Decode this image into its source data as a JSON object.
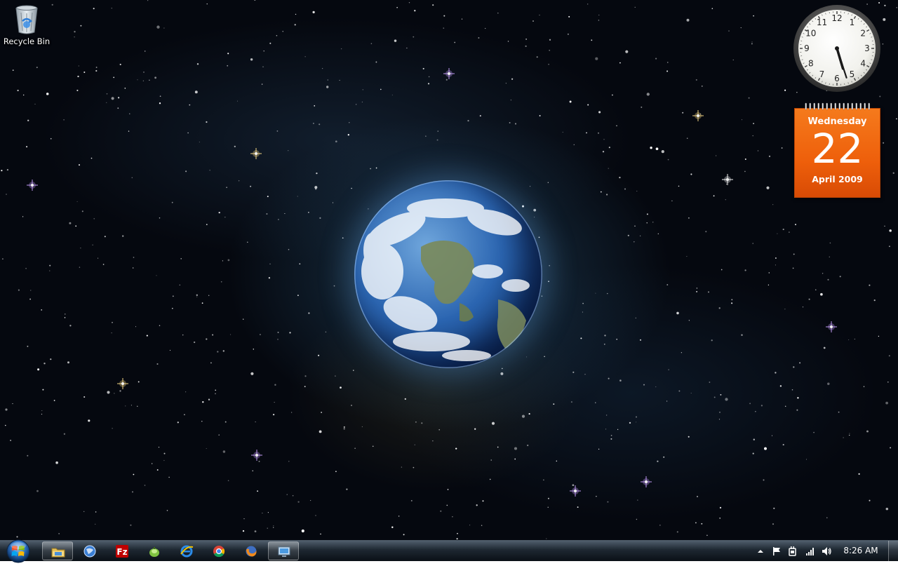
{
  "desktop": {
    "icons": [
      {
        "label": "Recycle Bin",
        "icon": "recycle-bin-icon"
      }
    ]
  },
  "gadgets": {
    "clock": {
      "time": "5:27",
      "numerals": [
        "12",
        "1",
        "2",
        "3",
        "4",
        "5",
        "6",
        "7",
        "8",
        "9",
        "10",
        "11"
      ]
    },
    "calendar": {
      "weekday": "Wednesday",
      "day": "22",
      "month_year": "April 2009",
      "color": "#ee5f0b"
    }
  },
  "taskbar": {
    "start_icon": "windows-logo-icon",
    "pinned": [
      {
        "name": "windows-explorer",
        "icon": "folder-icon",
        "active": true
      },
      {
        "name": "network-app",
        "icon": "globe-icon",
        "active": false
      },
      {
        "name": "filezilla",
        "icon": "filezilla-icon",
        "active": false
      },
      {
        "name": "green-app",
        "icon": "green-app-icon",
        "active": false
      },
      {
        "name": "internet-explorer",
        "icon": "internet-explorer-icon",
        "active": false
      },
      {
        "name": "google-chrome",
        "icon": "chrome-icon",
        "active": false
      },
      {
        "name": "firefox",
        "icon": "firefox-icon",
        "active": false
      },
      {
        "name": "remote-desktop",
        "icon": "monitor-icon",
        "active": true
      }
    ],
    "tray": {
      "icons": [
        "show-hidden-icons-arrow",
        "action-center-flag-icon",
        "power-icon",
        "network-signal-icon",
        "volume-icon"
      ],
      "time": "8:26 AM"
    }
  },
  "colors": {
    "calendar_orange": "#ee5f0b",
    "taskbar": "#19232d"
  }
}
